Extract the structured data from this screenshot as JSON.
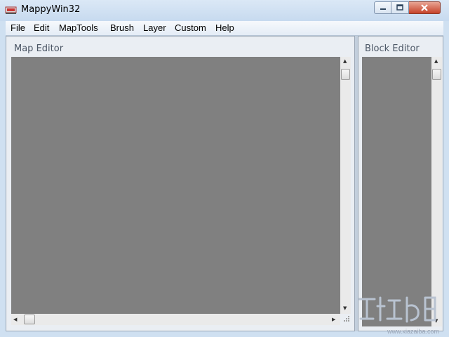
{
  "window": {
    "title": "MappyWin32"
  },
  "menu": {
    "items": [
      "File",
      "Edit",
      "MapTools",
      "Brush",
      "Layer",
      "Custom",
      "Help"
    ]
  },
  "panes": {
    "map_editor": {
      "label": "Map Editor"
    },
    "block_editor": {
      "label": "Block Editor"
    }
  },
  "watermark": {
    "text": "www.xiazaiba.com"
  },
  "colors": {
    "canvas": "#808080",
    "window_frame": "#cfe0f1",
    "close_button": "#c7432a"
  }
}
